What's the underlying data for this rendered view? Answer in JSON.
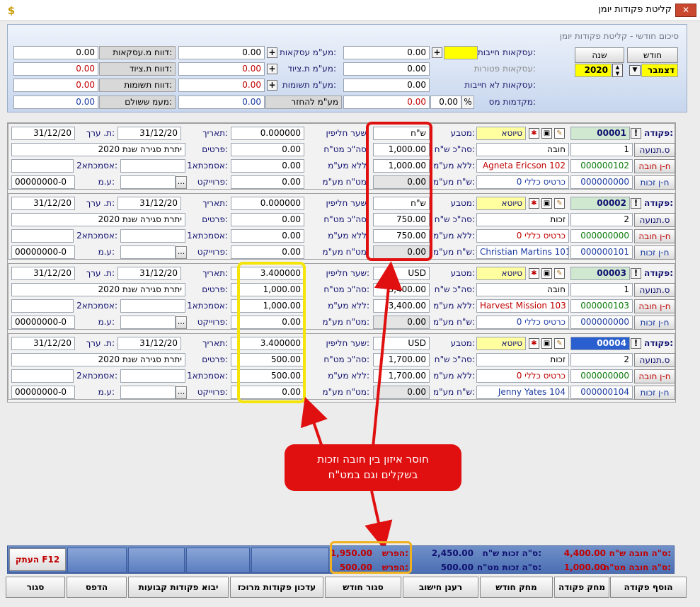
{
  "window": {
    "title": "קליטת פקודות יומן",
    "close": "✕",
    "app_icon": "$"
  },
  "section_title": "סיכום חודשי - קליטת פקודות יומן",
  "period": {
    "month_button": "חודש",
    "year_button": "שנה",
    "month_value": "דצמבר",
    "year_value": "2020"
  },
  "summary": {
    "col1": [
      {
        "label": "עסקאות חייבות:",
        "value": "0.00"
      },
      {
        "label": "עסקאות פטורות:",
        "value": "0.00"
      },
      {
        "label": "עסקאות לא חייבות:",
        "value": "0.00"
      },
      {
        "label": "מקדמות מס:",
        "value": "0.00",
        "pct_value": "0.00",
        "pct": "%"
      }
    ],
    "col2": [
      {
        "label": "מע\"מ עסקאות:",
        "value": "0.00"
      },
      {
        "label": "מע\"מ ת.ציוד:",
        "value": "0.00"
      },
      {
        "label": "מע\"מ תשומות:",
        "value": "0.00"
      },
      {
        "label": "מע\"מ להחזר",
        "value": "0.00"
      }
    ],
    "col3": [
      {
        "label": "דווח מ.עסקאות:",
        "value": "0.00"
      },
      {
        "label": "דווח ת.ציוד:",
        "value": "0.00"
      },
      {
        "label": "דווח תשומות:",
        "value": "0.00"
      },
      {
        "label": "מעמ ששולם:",
        "value": "0.00"
      }
    ]
  },
  "labels": {
    "voucher": "פקודה:",
    "movement_type": "ס.תנועה",
    "debit_acct": "ח-ן חובה",
    "credit_acct": "ח-ן זכות",
    "currency": "מטבע:",
    "draft": "טיוטא",
    "total_ils": "סה\"כ ש\"ח:",
    "no_vat": "ללא מע\"מ:",
    "vat_ils": "ש\"ח מע\"מ:",
    "rate": "שער חליפין:",
    "total_fx": "סה\"כ מט\"ח:",
    "no_vat_fx": "ללא מע\"מ:",
    "vat_fx": "מט\"ח מע\"מ:",
    "date": "תאריך:",
    "details": "פרטים:",
    "ref1": "אסמכתא1:",
    "project": "פרוייקט:",
    "value_date": "ת. ערך:",
    "ref2": "אסמכתא2:",
    "vat_no": "ע.מ:",
    "excl": "!"
  },
  "vouchers": [
    {
      "no": "00001",
      "type_num": "1",
      "type_name": "חובה",
      "debit_no": "000000102",
      "debit_name": "Agneta Ericson  102",
      "credit_no": "000000000",
      "credit_name": "כרטיס כללי 0",
      "currency": "ש\"ח",
      "total": "1,000.00",
      "no_vat": "1,000.00",
      "vat": "0.00",
      "rate": "0.000000",
      "total_fx": "0.00",
      "no_vat_fx": "0.00",
      "vat_fx": "0.00",
      "date": "31/12/20",
      "value_date": "31/12/20",
      "details": "יתרת סגירה שנת 2020",
      "vat_no": "00000000-0"
    },
    {
      "no": "00002",
      "type_num": "2",
      "type_name": "זכות",
      "debit_no": "000000000",
      "debit_name": "כרטיס כללי 0",
      "credit_no": "000000101",
      "credit_name": "Christian Martins  101",
      "currency": "ש\"ח",
      "total": "750.00",
      "no_vat": "750.00",
      "vat": "0.00",
      "rate": "0.000000",
      "total_fx": "0.00",
      "no_vat_fx": "0.00",
      "vat_fx": "0.00",
      "date": "31/12/20",
      "value_date": "31/12/20",
      "details": "יתרת סגירה שנת 2020",
      "vat_no": "00000000-0"
    },
    {
      "no": "00003",
      "type_num": "1",
      "type_name": "חובה",
      "debit_no": "000000103",
      "debit_name": "Harvest Mission  103",
      "credit_no": "000000000",
      "credit_name": "כרטיס כללי 0",
      "currency": "USD",
      "total": "3,400.00",
      "no_vat": "3,400.00",
      "vat": "0.00",
      "rate": "3.400000",
      "total_fx": "1,000.00",
      "no_vat_fx": "1,000.00",
      "vat_fx": "0.00",
      "date": "31/12/20",
      "value_date": "31/12/20",
      "details": "יתרת סגירה שנת 2020",
      "vat_no": "00000000-0"
    },
    {
      "no": "00004",
      "type_num": "2",
      "type_name": "זכות",
      "debit_no": "000000000",
      "debit_name": "כרטיס כללי 0",
      "credit_no": "000000104",
      "credit_name": "Jenny Yates  104",
      "currency": "USD",
      "total": "1,700.00",
      "no_vat": "1,700.00",
      "vat": "0.00",
      "rate": "3.400000",
      "total_fx": "500.00",
      "no_vat_fx": "500.00",
      "vat_fx": "0.00",
      "date": "31/12/20",
      "value_date": "31/12/20",
      "details": "יתרת סגירה שנת 2020",
      "vat_no": "00000000-0"
    }
  ],
  "callout": {
    "line1": "חוסר איזון בין חובה וזכות",
    "line2": "בשקלים וגם במט\"ח"
  },
  "totals": {
    "debit_ils_label": "ס\"ה חובה ש\"ח:",
    "debit_ils": "4,400.00",
    "debit_fx_label": "ס\"ה חובה מט\"ח:",
    "debit_fx": "1,000.00",
    "credit_ils_label": "ס\"ה זכות ש\"ח:",
    "credit_ils": "2,450.00",
    "credit_fx_label": "ס\"ה זכות מט\"ח:",
    "credit_fx": "500.00",
    "diff_label": "הפרש:",
    "diff_ils": "1,950.00",
    "diff_fx": "500.00",
    "copy_btn": "העתק F12"
  },
  "buttons": [
    "הוסף פקודה",
    "מחק פקודה",
    "מחק חודש",
    "רענן חישוב",
    "סגור חודש",
    "עדכון פקודות מרוכז",
    "יבוא פקודות קבועות",
    "הדפס",
    "סגור"
  ]
}
